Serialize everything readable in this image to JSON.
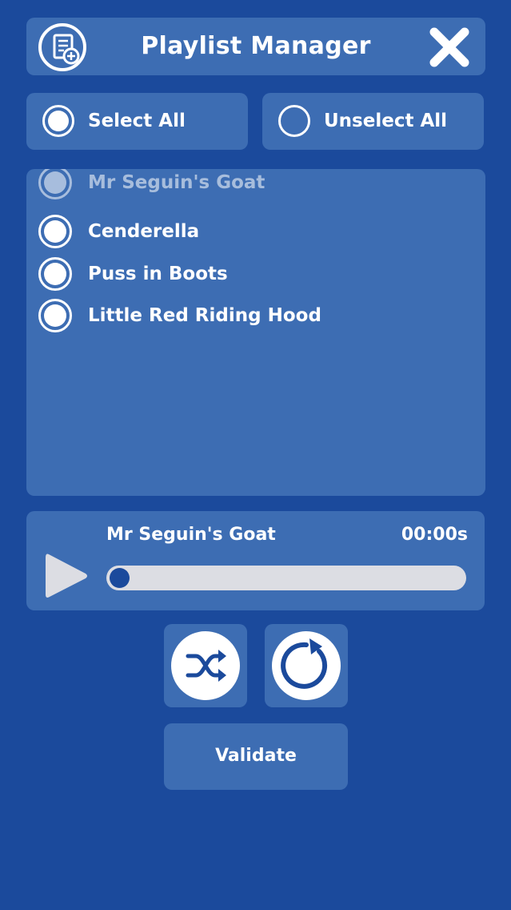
{
  "header": {
    "title": "Playlist Manager",
    "icon": "playlist-add-icon",
    "close_icon": "close-icon"
  },
  "selection": {
    "select_all_label": "Select All",
    "select_all_state": "selected",
    "unselect_all_label": "Unselect All",
    "unselect_all_state": "unselected"
  },
  "playlist": {
    "items": [
      {
        "title": "Mr Seguin's Goat",
        "selected": true
      },
      {
        "title": "Cenderella",
        "selected": true
      },
      {
        "title": "Puss in Boots",
        "selected": true
      },
      {
        "title": "Little Red Riding Hood",
        "selected": true
      }
    ]
  },
  "player": {
    "track_title": "Mr Seguin's Goat",
    "elapsed": "00:00s",
    "progress": 0,
    "play_icon": "play-icon"
  },
  "controls": {
    "shuffle_icon": "shuffle-icon",
    "repeat_icon": "repeat-icon"
  },
  "validate_label": "Validate",
  "colors": {
    "background": "#1b4a9c",
    "panel": "#3d6db3",
    "progress_track": "#dcdde3",
    "text": "#ffffff"
  }
}
